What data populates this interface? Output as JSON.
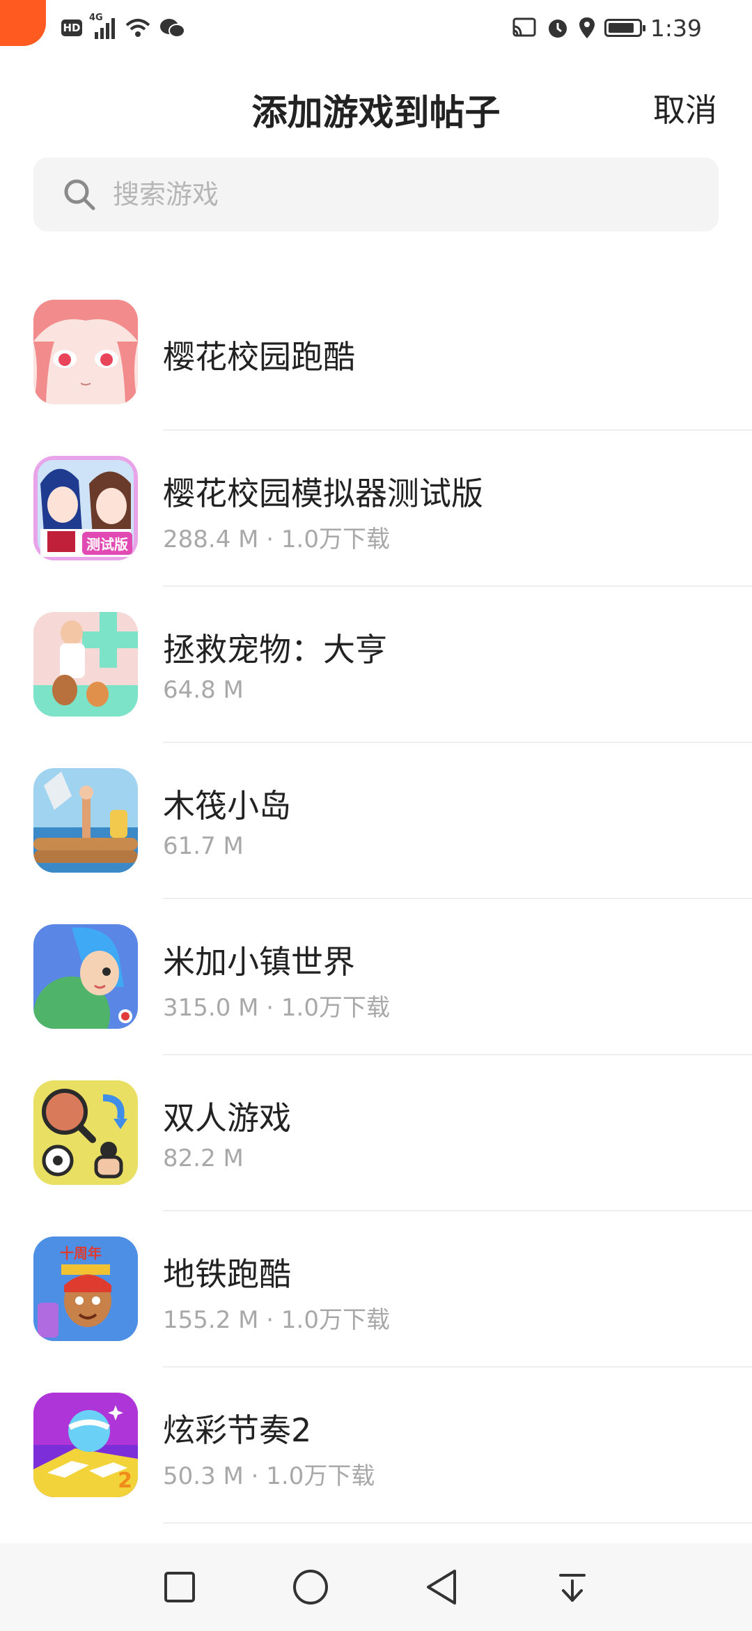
{
  "status": {
    "hd": "HD",
    "network": "4G",
    "time": "1:39",
    "battery_level": 0.85
  },
  "header": {
    "title": "添加游戏到帖子",
    "cancel_label": "取消"
  },
  "search": {
    "placeholder": "搜索游戏",
    "value": ""
  },
  "games": [
    {
      "name": "樱花校园跑酷",
      "meta": "",
      "icon": "anime-girl-face-icon",
      "icon_bg": "#fbe3df"
    },
    {
      "name": "樱花校园模拟器测试版",
      "meta": "288.4 M · 1.0万下载",
      "icon": "sakura-school-beta-icon",
      "icon_bg": "#e9a3e8",
      "badge": "测试版"
    },
    {
      "name": "拯救宠物：大亨",
      "meta": "64.8 M",
      "icon": "pet-rescue-tycoon-icon",
      "icon_bg": "#f6d9d6"
    },
    {
      "name": "木筏小岛",
      "meta": "61.7 M",
      "icon": "raft-island-icon",
      "icon_bg": "#9fd3f0"
    },
    {
      "name": "米加小镇世界",
      "meta": "315.0 M · 1.0万下载",
      "icon": "miga-town-icon",
      "icon_bg": "#5a86e6"
    },
    {
      "name": "双人游戏",
      "meta": "82.2 M",
      "icon": "two-player-games-icon",
      "icon_bg": "#e9df62"
    },
    {
      "name": "地铁跑酷",
      "meta": "155.2 M · 1.0万下载",
      "icon": "subway-surfers-icon",
      "icon_bg": "#3a6fd8",
      "badge": "十周年"
    },
    {
      "name": "炫彩节奏2",
      "meta": "50.3 M · 1.0万下载",
      "icon": "rhythm-ball-icon",
      "icon_bg": "#7c2fd8",
      "badge": "2"
    }
  ],
  "nav": {
    "recent": "square-icon",
    "home": "circle-icon",
    "back": "triangle-back-icon",
    "notifications": "pull-down-icon"
  }
}
